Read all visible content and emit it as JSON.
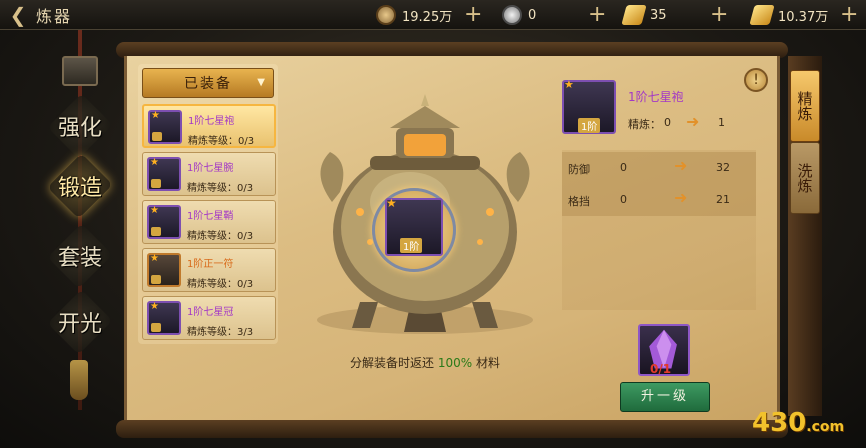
{
  "header": {
    "back_arrow": "❮",
    "title": "炼器"
  },
  "resources": [
    {
      "icon": "copper-coin-icon",
      "value": "19.25万",
      "color": "#b9925a"
    },
    {
      "icon": "silver-coin-icon",
      "value": "0",
      "color": "#a7a7a7"
    },
    {
      "icon": "gold-bars-icon",
      "value": "35",
      "color": "#e8b23a"
    },
    {
      "icon": "gold-ingot-icon",
      "value": "10.37万",
      "color": "#e8b23a"
    }
  ],
  "resource_plus": "+",
  "nav_tabs": [
    {
      "label": "强化",
      "active": false
    },
    {
      "label": "锻造",
      "active": true
    },
    {
      "label": "套装",
      "active": false
    },
    {
      "label": "开光",
      "active": false
    }
  ],
  "equip_list": {
    "header": "已装备",
    "caret": "▼",
    "items": [
      {
        "name": "1阶七星袍",
        "level": "精炼等级：0/3",
        "quality": "purple",
        "selected": true
      },
      {
        "name": "1阶七星腕",
        "level": "精炼等级：0/3",
        "quality": "purple",
        "selected": false
      },
      {
        "name": "1阶七星鞘",
        "level": "精炼等级：0/3",
        "quality": "purple",
        "selected": false
      },
      {
        "name": "1阶正一符",
        "level": "精炼等级：0/3",
        "quality": "orange",
        "selected": false
      },
      {
        "name": "1阶七星冠",
        "level": "精炼等级：3/3",
        "quality": "purple",
        "selected": false
      }
    ]
  },
  "cauldron": {
    "slot_badge": "1阶",
    "note_prefix": "分解装备时返还 ",
    "note_pct": "100%",
    "note_suffix": " 材料"
  },
  "detail": {
    "hint": "!",
    "badge": "1阶",
    "name": "1阶七星袍",
    "refine_label": "精炼：",
    "refine_from": "0",
    "refine_to": "1",
    "stats": [
      {
        "name": "防御",
        "from": "0",
        "to": "32"
      },
      {
        "name": "格挡",
        "from": "0",
        "to": "21"
      }
    ],
    "material_count": "0/1",
    "upgrade_button": "升一级"
  },
  "right_tabs": [
    {
      "label": "精炼",
      "active": true
    },
    {
      "label": "洗炼",
      "active": false
    }
  ],
  "watermark": {
    "main": "430",
    "suffix": ".com"
  },
  "colors": {
    "accent_orange": "#e2912a",
    "purple_quality": "#a338c6",
    "button_green": "#2f8a50"
  }
}
